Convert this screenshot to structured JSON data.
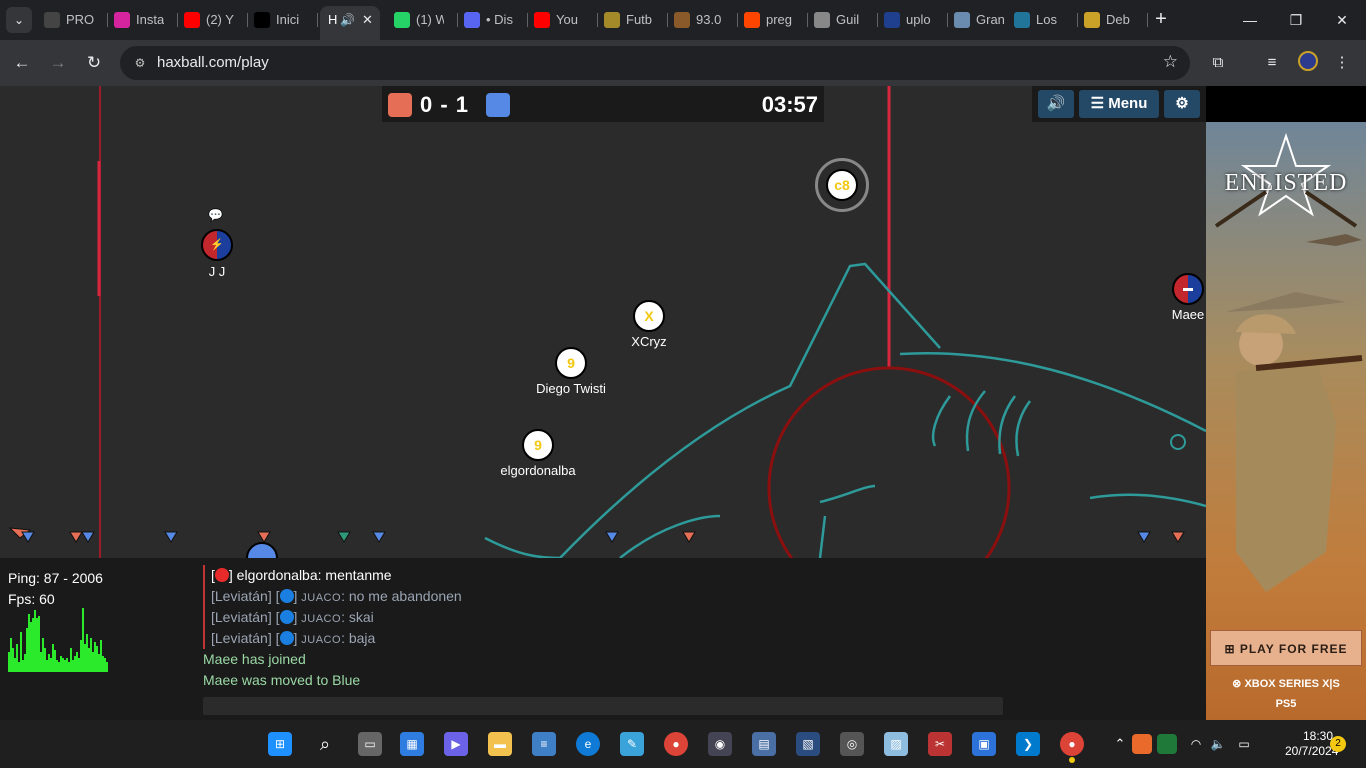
{
  "browser": {
    "tabs": [
      {
        "label": "PRO",
        "icon": "panda-icon",
        "color": "#444"
      },
      {
        "label": "Insta",
        "icon": "instagram-icon",
        "color": "#d6249f"
      },
      {
        "label": "(2) Y",
        "icon": "youtube-icon",
        "color": "#ff0000"
      },
      {
        "label": "Inici",
        "icon": "x-icon",
        "color": "#000"
      },
      {
        "label": "H",
        "icon": "speaker-icon",
        "color": "#35363a",
        "active": true
      },
      {
        "label": "(1) W",
        "icon": "whatsapp-icon",
        "color": "#25d366"
      },
      {
        "label": "• Dis",
        "icon": "discord-icon",
        "color": "#5865f2"
      },
      {
        "label": "You",
        "icon": "youtube-icon",
        "color": "#ff0000"
      },
      {
        "label": "Futb",
        "icon": "shield-icon",
        "color": "#a58a2a"
      },
      {
        "label": "93.0",
        "icon": "radio-icon",
        "color": "#8b5a2b"
      },
      {
        "label": "preg",
        "icon": "reddit-icon",
        "color": "#ff4500"
      },
      {
        "label": "Guil",
        "icon": "bank-icon",
        "color": "#888"
      },
      {
        "label": "uplo",
        "icon": "wiki-icon",
        "color": "#1f3f8f"
      },
      {
        "label": "Gran",
        "icon": "globe-icon",
        "color": "#6a8caf"
      },
      {
        "label": "Los",
        "icon": "wordpress-icon",
        "color": "#21759b"
      },
      {
        "label": "Deb",
        "icon": "crest-icon",
        "color": "#c9a227"
      }
    ],
    "url": "haxball.com/play"
  },
  "game": {
    "score": "0 - 1",
    "red_color": "#e56e56",
    "blue_color": "#5689e5",
    "timer": "03:57",
    "menu_label": "Menu",
    "players": [
      {
        "name": "J J",
        "avatar": "",
        "team": "red"
      },
      {
        "name": "XCryz",
        "avatar": "X",
        "team": "white"
      },
      {
        "name": "Diego Twisti",
        "avatar": "9",
        "team": "white"
      },
      {
        "name": "elgordonalba",
        "avatar": "9",
        "team": "white"
      },
      {
        "name": "Maee",
        "avatar": "",
        "team": "blue"
      },
      {
        "name": "",
        "avatar": "c8",
        "team": "spectator"
      }
    ]
  },
  "stats": {
    "ping": "Ping: 87 - 2006",
    "fps": "Fps: 60"
  },
  "chat": [
    {
      "prefix": "[",
      "suffix": "] elgordonalba: mentanme",
      "team": "red",
      "own": true
    },
    {
      "prefix": "[Leviatán] [",
      "suffix": "] ",
      "sc": "JUACO",
      "text": ": no me abandonen",
      "team": "blue"
    },
    {
      "prefix": "[Leviatán] [",
      "suffix": "] ",
      "sc": "JUACO",
      "text": ": skai",
      "team": "blue"
    },
    {
      "prefix": "[Leviatán] [",
      "suffix": "] ",
      "sc": "JUACO",
      "text": ": baja",
      "team": "blue"
    },
    {
      "notice": "Maee has joined"
    },
    {
      "notice": "Maee was moved to Blue"
    }
  ],
  "ad": {
    "brand": "ENLISTED",
    "cta": "PLAY FOR FREE",
    "platform1": "XBOX SERIES X|S",
    "platform2": "PS5"
  },
  "taskbar": {
    "time": "18:30",
    "date": "20/7/2024",
    "notifications": "2"
  }
}
